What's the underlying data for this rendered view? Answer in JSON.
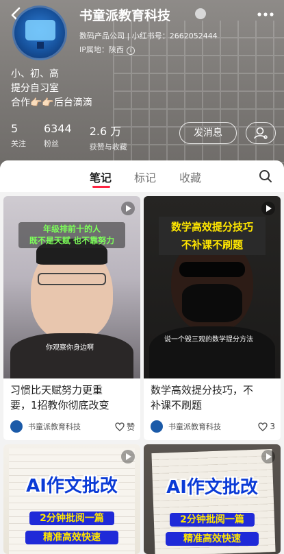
{
  "profile": {
    "name": "书童派教育科技",
    "category": "数码产品公司",
    "id_line": "小红书号：2662052444",
    "location": "IP属地：陕西",
    "bio": [
      "小、初、高",
      "提分自习室",
      "合作👉🏻👉🏻后台滴滴"
    ],
    "stats": [
      {
        "num": "5",
        "label": "关注"
      },
      {
        "num": "6344",
        "label": "粉丝"
      },
      {
        "num": "2.6 万",
        "label": "获赞与收藏"
      }
    ],
    "message_button": "发消息"
  },
  "tabs": [
    {
      "label": "笔记",
      "active": true
    },
    {
      "label": "标记",
      "active": false
    },
    {
      "label": "收藏",
      "active": false
    }
  ],
  "notes": [
    {
      "title": "习惯比天赋努力更重要，1招教你彻底改变",
      "title_lines": [
        "习惯比天赋努力更重",
        "要，1招教你彻底改变"
      ],
      "author": "书童派教育科技",
      "likes": "赞",
      "cover_caption": [
        "年级排前十的人",
        "既不是天赋 也不靠努力"
      ],
      "cover_subtitle": "你观察你身边啊"
    },
    {
      "title": "数学高效提分技巧，不补课不刷题",
      "title_lines": [
        "数学高效提分技巧，不",
        "补课不刷题"
      ],
      "author": "书童派教育科技",
      "likes": "3",
      "cover_caption": [
        "数学高效提分技巧",
        "不补课不刷题"
      ],
      "cover_subtitle": "说一个毁三观的数学提分方法"
    },
    {
      "cover_caption": [
        "AI作文批改"
      ],
      "cover_subtitle_lines": [
        "2分钟批阅一篇",
        "精准高效快速"
      ]
    },
    {
      "cover_caption": [
        "AI作文批改"
      ],
      "cover_subtitle_lines": [
        "2分钟批阅一篇",
        "精准高效快速"
      ]
    }
  ],
  "colors": {
    "accent": "#ff2442",
    "header_bg": "#7d7a77"
  }
}
